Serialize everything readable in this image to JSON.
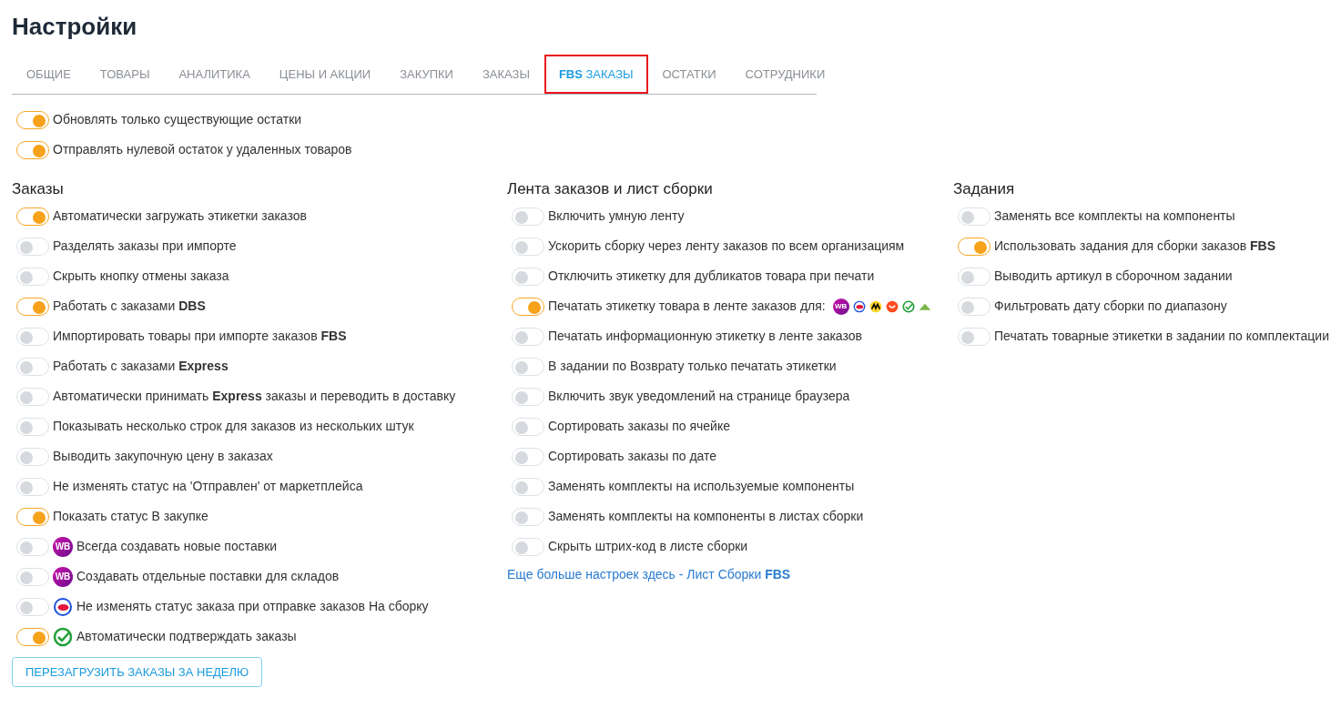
{
  "title": "Настройки",
  "tabs": [
    {
      "label": "ОБЩИЕ",
      "selected": false
    },
    {
      "label": "ТОВАРЫ",
      "selected": false
    },
    {
      "label": "АНАЛИТИКА",
      "selected": false
    },
    {
      "label": "ЦЕНЫ И АКЦИИ",
      "selected": false
    },
    {
      "label": "ЗАКУПКИ",
      "selected": false
    },
    {
      "label": "ЗАКАЗЫ",
      "selected": false
    },
    {
      "label": "**FBS** ЗАКАЗЫ",
      "selected": true
    },
    {
      "label": "ОСТАТКИ",
      "selected": false
    },
    {
      "label": "СОТРУДНИКИ",
      "selected": false
    }
  ],
  "general_toggles": [
    {
      "label": "Обновлять только существующие остатки",
      "on": true
    },
    {
      "label": "Отправлять нулевой остаток у удаленных товаров",
      "on": true
    }
  ],
  "columns": [
    {
      "heading": "Заказы",
      "toggles": [
        {
          "label": "Автоматически загружать этикетки заказов",
          "on": true
        },
        {
          "label": "Разделять заказы при импорте",
          "on": false
        },
        {
          "label": "Скрыть кнопку отмены заказа",
          "on": false
        },
        {
          "label": "Работать с заказами **DBS**",
          "on": true
        },
        {
          "label": "Импортировать товары при импорте заказов **FBS**",
          "on": false
        },
        {
          "label": "Работать с заказами **Express**",
          "on": false
        },
        {
          "label": "Автоматически принимать **Express** заказы и переводить в доставку",
          "on": false
        },
        {
          "label": "Показывать несколько строк для заказов из нескольких штук",
          "on": false
        },
        {
          "label": "Выводить закупочную цену в заказах",
          "on": false
        },
        {
          "label": "Не изменять статус на 'Отправлен' от маркетплейса",
          "on": false
        },
        {
          "label": "Показать статус В закупке",
          "on": true
        },
        {
          "label": "Всегда создавать новые поставки",
          "on": false,
          "icons": [
            {
              "kind": "badge",
              "text": "WB"
            }
          ]
        },
        {
          "label": "Создавать отдельные поставки для складов",
          "on": false,
          "icons": [
            {
              "kind": "badge",
              "text": "WB"
            }
          ]
        },
        {
          "label": "Не изменять статус заказа при отправке заказов На сборку",
          "on": false,
          "icons": [
            {
              "kind": "ring"
            }
          ]
        },
        {
          "label": "Автоматически подтверждать заказы",
          "on": true,
          "icons": [
            {
              "kind": "check"
            }
          ]
        }
      ],
      "button": "ПЕРЕЗАГРУЗИТЬ ЗАКАЗЫ ЗА НЕДЕЛЮ"
    },
    {
      "heading": "Лента заказов и лист сборки",
      "toggles": [
        {
          "label": "Включить умную ленту",
          "on": false
        },
        {
          "label": "Ускорить сборку через ленту заказов по всем организациям",
          "on": false
        },
        {
          "label": "Отключить этикетку для дубликатов товара при печати",
          "on": false
        },
        {
          "label": "Печатать этикетку товара в ленте заказов  для:",
          "on": true,
          "trailing_icons": [
            {
              "kind": "badge",
              "text": "WB"
            },
            {
              "kind": "ring"
            },
            {
              "kind": "squiggle"
            },
            {
              "kind": "smile"
            },
            {
              "kind": "check"
            },
            {
              "kind": "triangle"
            }
          ]
        },
        {
          "label": "Печатать информационную этикетку в ленте заказов",
          "on": false
        },
        {
          "label": "В задании по Возврату только печатать этикетки",
          "on": false
        },
        {
          "label": "Включить звук уведомлений на странице браузера",
          "on": false
        },
        {
          "label": "Сортировать заказы по ячейке",
          "on": false
        },
        {
          "label": "Сортировать заказы по дате",
          "on": false
        },
        {
          "label": "Заменять комплекты на используемые компоненты",
          "on": false
        },
        {
          "label": "Заменять комплекты на компоненты в листах сборки",
          "on": false
        },
        {
          "label": "Скрыть штрих-код в листе сборки",
          "on": false
        }
      ],
      "link": "Еще больше настроек здесь - Лист Сборки **FBS**"
    },
    {
      "heading": "Задания",
      "toggles": [
        {
          "label": "Заменять все комплекты на компоненты",
          "on": false
        },
        {
          "label": "Использовать задания для сборки заказов **FBS**",
          "on": true
        },
        {
          "label": "Выводить артикул в сборочном задании",
          "on": false
        },
        {
          "label": "Фильтровать дату сборки по диапазону",
          "on": false
        },
        {
          "label": "Печатать товарные этикетки в задании по комплектации",
          "on": false
        }
      ]
    }
  ]
}
